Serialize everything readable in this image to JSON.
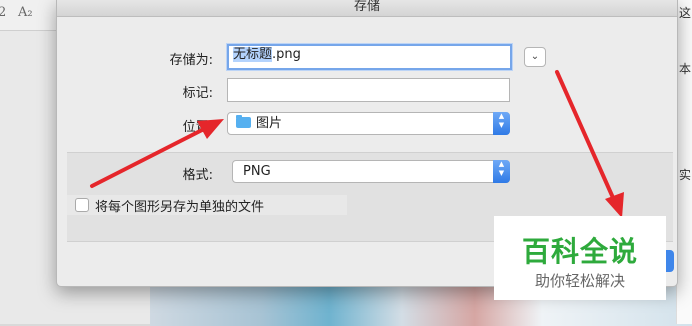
{
  "dialog": {
    "title": "存储",
    "save_as_label": "存储为:",
    "filename_selected": "无标题",
    "filename_ext": ".png",
    "tags_label": "标记:",
    "tags_value": "",
    "location_label": "位置:",
    "location_value": "图片",
    "format_label": "格式:",
    "format_value": "PNG",
    "save_each_label": "将每个图形另存为单独的文件",
    "save_each_checked": false
  },
  "background": {
    "toolbar_glyphs": [
      "2",
      "A₂"
    ],
    "right_edge_glyphs": [
      "这",
      "本",
      "实"
    ]
  },
  "watermark": {
    "title": "百科全说",
    "subtitle": "助你轻松解决"
  },
  "colors": {
    "annotation_arrow": "#e5262b",
    "watermark_green": "#2eaa3c",
    "accent_blue": "#3f86ea"
  }
}
